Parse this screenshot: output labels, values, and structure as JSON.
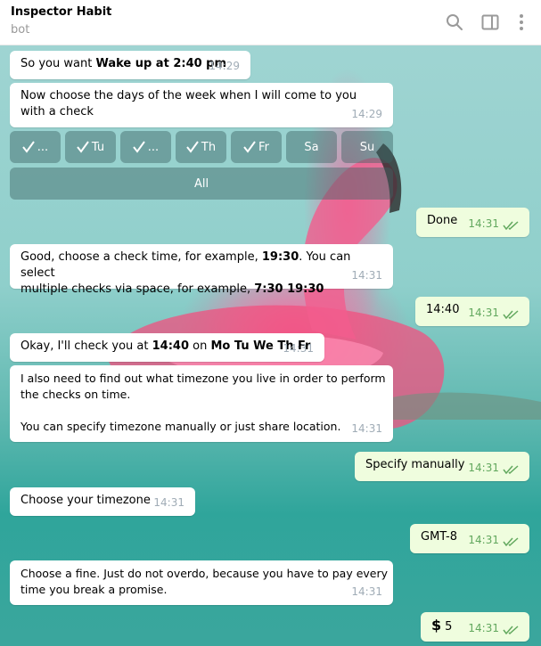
{
  "header": {
    "title": "Inspector Habit",
    "subtitle": "bot",
    "icons": [
      "search-icon",
      "sidebar-toggle-icon",
      "more-vertical-icon"
    ]
  },
  "messages": {
    "m1": {
      "prefix": "So you want ",
      "bold": "Wake up at 2:40 pm",
      "time": "14:29"
    },
    "m2": {
      "text": "Now choose the days of the week when I will come to you with a check",
      "time": "14:29"
    },
    "keyboard": {
      "days": [
        {
          "label": "...",
          "checked": true
        },
        {
          "label": "Tu",
          "checked": true
        },
        {
          "label": "...",
          "checked": true
        },
        {
          "label": "Th",
          "checked": true
        },
        {
          "label": "Fr",
          "checked": true
        },
        {
          "label": "Sa",
          "checked": false
        },
        {
          "label": "Su",
          "checked": false
        }
      ],
      "all_label": "All"
    },
    "m3": {
      "text": "Done",
      "time": "14:31"
    },
    "m4": {
      "line1_prefix": "Good, choose a check time, for example, ",
      "line1_bold": "19:30",
      "line1_suffix": ". You can select",
      "line2_prefix": "multiple checks via space, for example, ",
      "line2_bold": "7:30 19:30",
      "time": "14:31"
    },
    "m5": {
      "text": "14:40",
      "time": "14:31"
    },
    "m6": {
      "prefix": "Okay, I'll check you at ",
      "bold1": "14:40",
      "mid": " on ",
      "bold2": "Mo Tu We Th Fr",
      "time": "14:31"
    },
    "m7": {
      "line1": "I also need to find out what timezone you live in order to perform",
      "line2": "the checks on time.",
      "line3": "You can specify timezone manually or just share location.",
      "time": "14:31"
    },
    "m8": {
      "text": "Specify manually",
      "time": "14:31"
    },
    "m9": {
      "text": "Choose your timezone",
      "time": "14:31"
    },
    "m10": {
      "text": "GMT-8",
      "time": "14:31"
    },
    "m11": {
      "line1": "Choose a fine. Just do not overdo, because you have to pay every",
      "line2": "time you break a promise.",
      "time": "14:31"
    },
    "m12": {
      "symbol": "$",
      "text": "5",
      "time": "14:31"
    }
  },
  "colors": {
    "incoming_bubble": "#ffffff",
    "outgoing_bubble": "#effdde",
    "outgoing_time": "#62a85e",
    "incoming_time": "#a0acb6",
    "keyboard_button": "rgba(60,100,100,0.45)"
  }
}
